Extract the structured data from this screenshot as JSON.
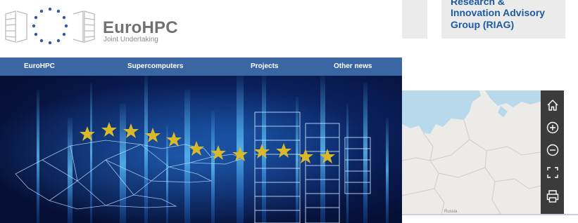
{
  "logo": {
    "name": "EuroHPC",
    "subtitle": "Joint Undertaking"
  },
  "nav": {
    "items": [
      "EuroHPC",
      "Supercomputers",
      "Projects",
      "Other news"
    ]
  },
  "card": {
    "lines": [
      "Research &",
      "Innovation Advisory",
      "Group (RIAG)"
    ]
  },
  "map": {
    "label": "Russia",
    "tools": [
      "home-icon",
      "zoom-in-icon",
      "zoom-out-icon",
      "fullscreen-icon",
      "print-icon"
    ]
  },
  "colors": {
    "nav_bg": "#3a67a4",
    "card_text": "#1e5aa0",
    "map_toolbar": "#3b3b3b",
    "star": "#d9b92a"
  }
}
